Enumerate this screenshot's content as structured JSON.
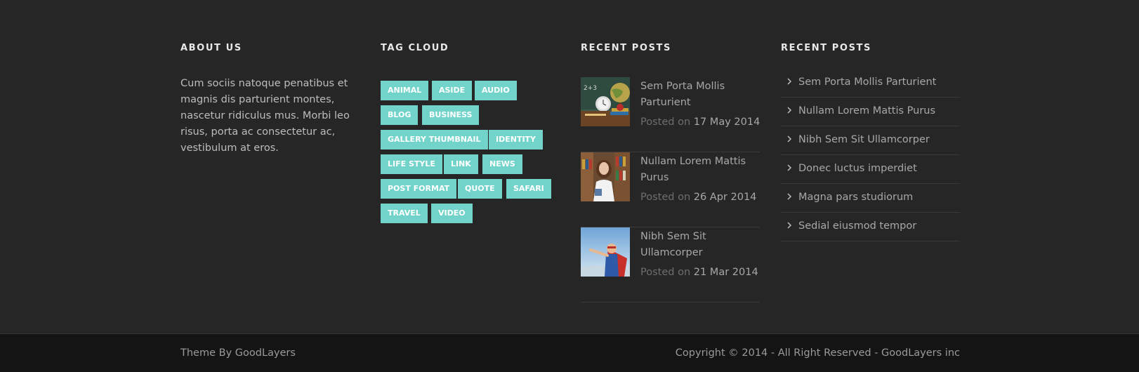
{
  "about": {
    "title": "About Us",
    "text": "Cum sociis natoque penatibus et magnis dis parturient montes, nascetur ridiculus mus. Morbi leo risus, porta ac consectetur ac, vestibulum at eros."
  },
  "tag_cloud": {
    "title": "Tag Cloud",
    "tags": [
      "Animal",
      "Aside",
      "Audio",
      "Blog",
      "Business",
      "Gallery Thumbnail",
      "Identity",
      "Life Style",
      "Link",
      "News",
      "Post Format",
      "Quote",
      "Safari",
      "Travel",
      "Video"
    ]
  },
  "recent_posts_thumbs": {
    "title": "Recent Posts",
    "posted_on_label": "Posted on",
    "posts": [
      {
        "title": "Sem Porta Mollis Parturient",
        "date": "17 May 2014",
        "thumb_icon": "classroom-desk-thumbnail"
      },
      {
        "title": "Nullam Lorem Mattis Purus",
        "date": "26 Apr 2014",
        "thumb_icon": "student-library-thumbnail"
      },
      {
        "title": "Nibh Sem Sit Ullamcorper",
        "date": "21 Mar 2014",
        "thumb_icon": "superhero-kid-thumbnail"
      }
    ]
  },
  "recent_posts_list": {
    "title": "Recent Posts",
    "items": [
      "Sem Porta Mollis Parturient",
      "Nullam Lorem Mattis Purus",
      "Nibh Sem Sit Ullamcorper",
      "Donec luctus imperdiet",
      "Magna pars studiorum",
      "Sedial eiusmod tempor"
    ]
  },
  "copyright": {
    "left": "Theme By GoodLayers",
    "right": "Copyright © 2014 - All Right Reserved - GoodLayers inc"
  },
  "colors": {
    "background": "#262626",
    "copyright_background": "#141414",
    "tag_accent": "#72d3ca"
  }
}
